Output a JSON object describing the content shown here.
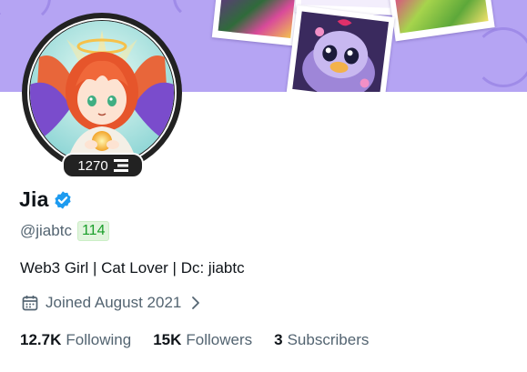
{
  "profile": {
    "display_name": "Jia",
    "handle": "@jiabtc",
    "score": "114",
    "avatar_badge_count": "1270",
    "bio": "Web3 Girl | Cat Lover | Dc: jiabtc",
    "joined": "Joined August 2021"
  },
  "stats": [
    {
      "number": "12.7K",
      "label": "Following"
    },
    {
      "number": "15K",
      "label": "Followers"
    },
    {
      "number": "3",
      "label": "Subscribers"
    }
  ],
  "colors": {
    "banner": "#b5a4f3",
    "verified": "#1d9bf0",
    "score_bg": "#e1f4dd",
    "score_text": "#1a9e2a",
    "secondary_text": "#536471"
  },
  "icons": {
    "verified": "verified-check-icon",
    "calendar": "calendar-icon",
    "chevron": "chevron-right-icon",
    "badge": "stacked-bars-icon"
  }
}
